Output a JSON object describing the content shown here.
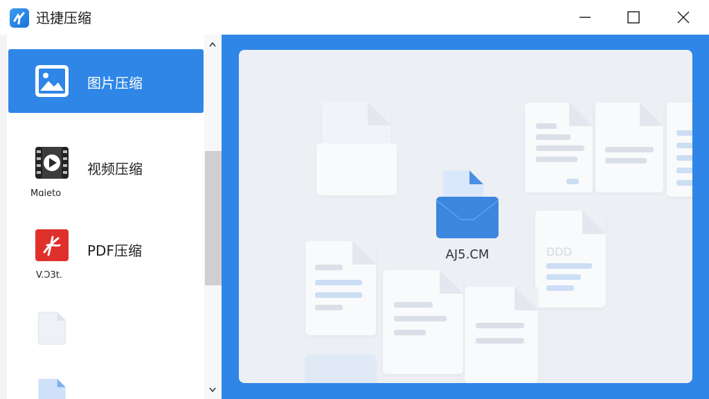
{
  "window": {
    "title": "迅捷压缩",
    "controls": [
      "minimize-icon",
      "maximize-icon",
      "close-icon"
    ]
  },
  "sidebar": {
    "items": [
      {
        "label": "图片压缩",
        "icon": "image-icon",
        "active": true
      },
      {
        "label": "视频压缩",
        "icon": "video-icon",
        "sub": "Mɑieto"
      },
      {
        "label": "PDF压缩",
        "icon": "pdf-icon",
        "sub": "V.Ɔ3t."
      },
      {
        "label": "",
        "icon": "blank-file-icon"
      },
      {
        "label": "",
        "icon": "file-icon"
      }
    ]
  },
  "main": {
    "center_label": "AJ5.CM",
    "decor_text": "DDD"
  },
  "colors": {
    "accent": "#2f86e6",
    "canvas": "#eceff4"
  }
}
